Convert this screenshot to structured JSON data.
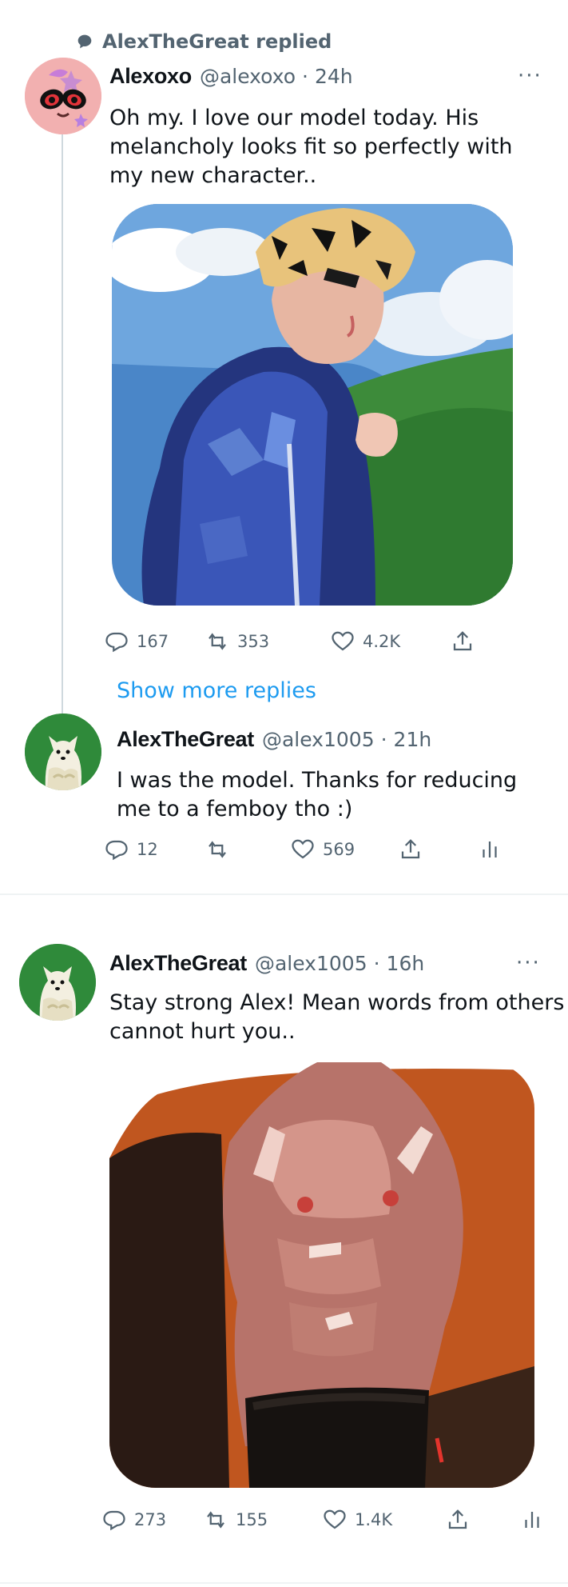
{
  "context": {
    "replied_text": "AlexTheGreat replied"
  },
  "tweets": [
    {
      "name": "Alexoxo",
      "handle": "@alexoxo",
      "time": "24h",
      "text_lines": [
        "Oh my. I love our model today. His",
        "melancholy looks fit so perfectly with",
        "my new character.."
      ],
      "replies": "167",
      "retweets": "353",
      "likes": "4.2K"
    },
    {
      "name": "AlexTheGreat",
      "handle": "@alex1005",
      "time": "21h",
      "text_lines": [
        "I was the model. Thanks for reducing",
        "me to a femboy tho :)"
      ],
      "replies": "12",
      "likes": "569"
    },
    {
      "name": "AlexTheGreat",
      "handle": "@alex1005",
      "time": "16h",
      "text_lines": [
        "Stay strong Alex! Mean words from others",
        "cannot hurt you.."
      ],
      "replies": "273",
      "retweets": "155",
      "likes": "1.4K"
    }
  ],
  "show_more_replies": "Show more replies",
  "separator": "·",
  "more_glyph": "···",
  "colors": {
    "link": "#1d9bf0",
    "muted": "#536471",
    "text": "#0f1419",
    "avatar_green": "#2f8a3a",
    "avatar_pink": "#f2b0b0"
  },
  "icons": [
    "speech-bubble-icon",
    "reply-icon",
    "retweet-icon",
    "like-icon",
    "share-icon",
    "analytics-icon",
    "more-icon"
  ]
}
